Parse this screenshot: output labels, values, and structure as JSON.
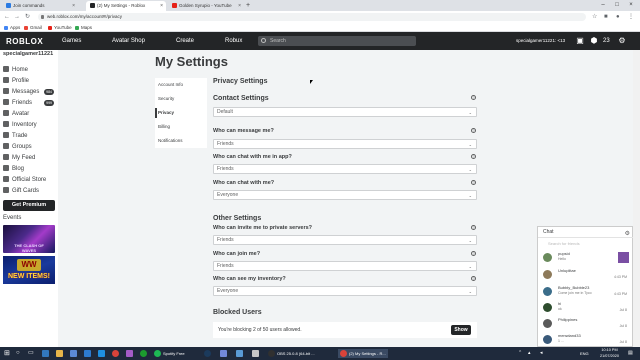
{
  "browser": {
    "tabs": [
      {
        "label": "Join commands",
        "color": "#2a7ae2"
      },
      {
        "label": "(2) My Settings - Roblox",
        "color": "#232527"
      },
      {
        "label": "Golden Syrupio - YouTube",
        "color": "#e62117"
      }
    ],
    "new_tab": "+",
    "url": "web.roblox.com/my/account#!/privacy",
    "bookmarks": [
      {
        "label": "Apps",
        "color": "#4285f4"
      },
      {
        "label": "Gmail",
        "color": "#ea4335"
      },
      {
        "label": "YouTube",
        "color": "#e62117"
      },
      {
        "label": "Maps",
        "color": "#34a853"
      }
    ]
  },
  "header": {
    "logo": "ROBLOX",
    "nav": [
      "Games",
      "Avatar Shop",
      "Create",
      "Robux"
    ],
    "search_placeholder": "Search",
    "username": "specialgamer11221: <13",
    "robux": "23"
  },
  "sidebar": {
    "username": "specialgamer11221",
    "items": [
      {
        "label": "Home",
        "badge": ""
      },
      {
        "label": "Profile",
        "badge": ""
      },
      {
        "label": "Messages",
        "badge": "984"
      },
      {
        "label": "Friends",
        "badge": "999"
      },
      {
        "label": "Avatar",
        "badge": ""
      },
      {
        "label": "Inventory",
        "badge": ""
      },
      {
        "label": "Trade",
        "badge": ""
      },
      {
        "label": "Groups",
        "badge": ""
      },
      {
        "label": "My Feed",
        "badge": ""
      },
      {
        "label": "Blog",
        "badge": ""
      },
      {
        "label": "Official Store",
        "badge": ""
      },
      {
        "label": "Gift Cards",
        "badge": ""
      }
    ],
    "premium": "Get Premium",
    "events": "Events",
    "event1_text": "THE CLASH OF WAVES",
    "event2_logo": "WW",
    "event2_text": "NEW ITEMS!"
  },
  "page": {
    "title": "My Settings",
    "menu": [
      "Account Info",
      "Security",
      "Privacy",
      "Billing",
      "Notifications"
    ],
    "section_title": "Privacy Settings",
    "contact_title": "Contact Settings",
    "contact_default": "Default",
    "q_message": "Who can message me?",
    "v_message": "Friends",
    "q_chat_app": "Who can chat with me in app?",
    "v_chat_app": "Friends",
    "q_chat": "Who can chat with me?",
    "v_chat": "Everyone",
    "other_title": "Other Settings",
    "q_invite": "Who can invite me to private servers?",
    "v_invite": "Friends",
    "q_join": "Who can join me?",
    "v_join": "Friends",
    "q_inventory": "Who can see my inventory?",
    "v_inventory": "Everyone",
    "blocked_title": "Blocked Users",
    "blocked_text": "You're blocking 2 of 50 users allowed.",
    "show_button": "Show"
  },
  "chat": {
    "title": "Chat",
    "search_placeholder": "Search for friends",
    "items": [
      {
        "name": "pupsid",
        "msg": "Hello",
        "time": "",
        "color": "#6a8a5c"
      },
      {
        "name": "Unluplitae",
        "msg": "",
        "time": "4:43 PM",
        "color": "#8d7a5a"
      },
      {
        "name": "Bubbly_Bubble23",
        "msg": "Come join me in Tyco",
        "time": "4:43 PM",
        "color": "#3b6d8a"
      },
      {
        "name": "hi",
        "msg": "ok",
        "time": "Jul 8",
        "color": "#2e4d2e"
      },
      {
        "name": "Philippines",
        "msg": "",
        "time": "Jul 8",
        "color": "#5a5a5a"
      },
      {
        "name": "menwland33",
        "msg": "1 ...",
        "time": "Jul 8",
        "color": "#3a5a7a"
      }
    ]
  },
  "taskbar": {
    "spotify": "Spotify Free",
    "obs": "OBS 25.0.8 (64-bit ...",
    "chrome": "(2) My Settings - R...",
    "lang": "ENG",
    "time": "10:10 PM",
    "date": "21/07/2020"
  }
}
